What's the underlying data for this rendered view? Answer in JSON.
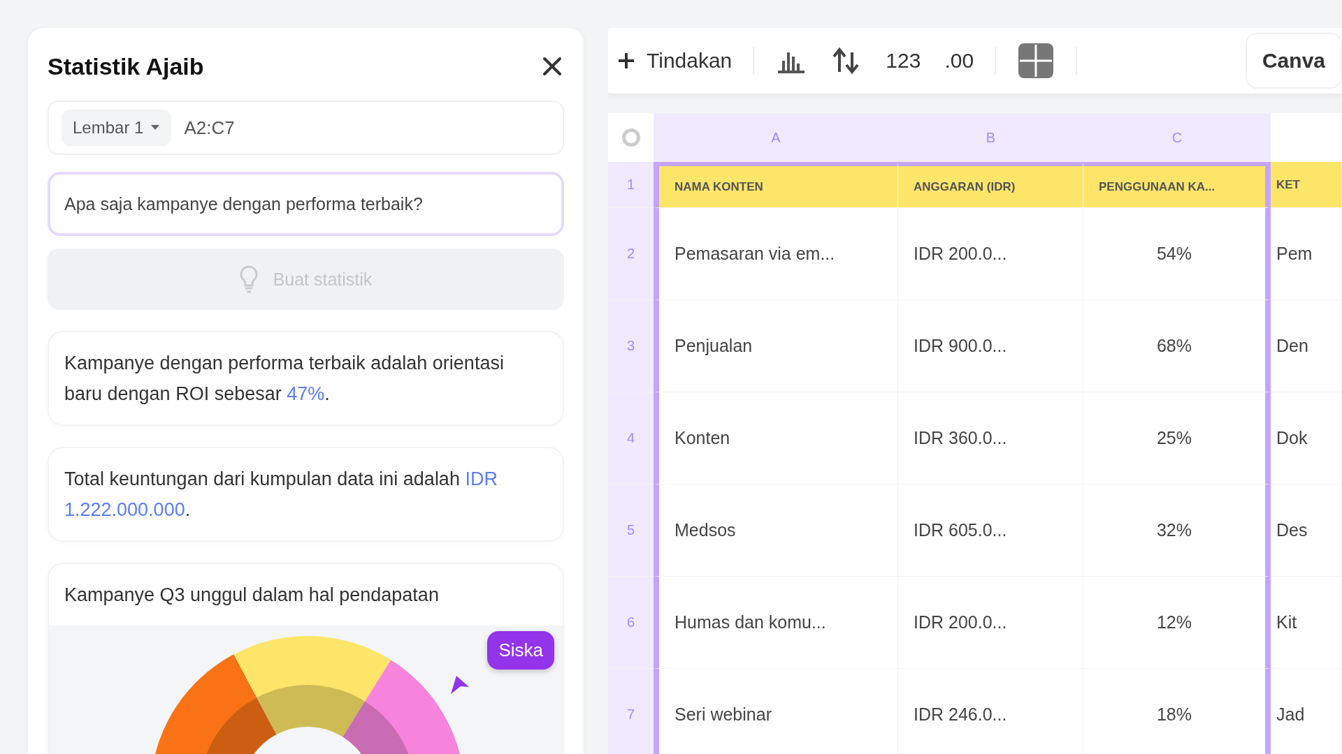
{
  "panel": {
    "title": "Statistik Ajaib",
    "sheet_select": "Lembar 1",
    "range": "A2:C7",
    "query": "Apa saja kampanye dengan performa terbaik?",
    "generate_button": {
      "label": "Buat statistik",
      "disabled": true
    },
    "insights": [
      {
        "kind": "text",
        "text": "Kampanye dengan performa terbaik adalah orientasi baru dengan ROI sebesar **47%**."
      },
      {
        "kind": "text",
        "text": "Total keuntungan dari kumpulan data ini adalah **IDR 1.222.000.000**."
      },
      {
        "kind": "chart",
        "text": "Kampanye Q3 unggul dalam hal pendapatan",
        "cursor": "Siska"
      }
    ]
  },
  "toolbar": {
    "action": "Tindakan",
    "number_format": "123",
    "decimal_format": ".00",
    "button": "Canva"
  },
  "sheet": {
    "columns": [
      {
        "label": "A",
        "selected": true
      },
      {
        "label": "B",
        "selected": true
      },
      {
        "label": "C",
        "selected": true
      }
    ],
    "rows": [
      {
        "number": "1",
        "selected": true,
        "kind": "header",
        "cells": [
          "NAMA KONTEN",
          "ANGGARAN (IDR)",
          "PENGGUNAAN KA...",
          "KET"
        ]
      },
      {
        "number": "2",
        "selected": true,
        "kind": "data",
        "cells": [
          "Pemasaran via em...",
          "IDR 200.0...",
          "54%",
          "Pem"
        ]
      },
      {
        "number": "3",
        "selected": true,
        "kind": "data",
        "cells": [
          "Penjualan",
          "IDR 900.0...",
          "68%",
          "Den"
        ]
      },
      {
        "number": "4",
        "selected": true,
        "kind": "data",
        "cells": [
          "Konten",
          "IDR 360.0...",
          "25%",
          "Dok"
        ]
      },
      {
        "number": "5",
        "selected": true,
        "kind": "data",
        "cells": [
          "Medsos",
          "IDR 605.0...",
          "32%",
          "Des"
        ]
      },
      {
        "number": "6",
        "selected": true,
        "kind": "data",
        "cells": [
          "Humas dan komu...",
          "IDR 200.0...",
          "12%",
          "Kit"
        ]
      },
      {
        "number": "7",
        "selected": true,
        "kind": "data",
        "cells": [
          "Seri webinar",
          "IDR 246.0...",
          "18%",
          "Jad"
        ]
      }
    ]
  }
}
